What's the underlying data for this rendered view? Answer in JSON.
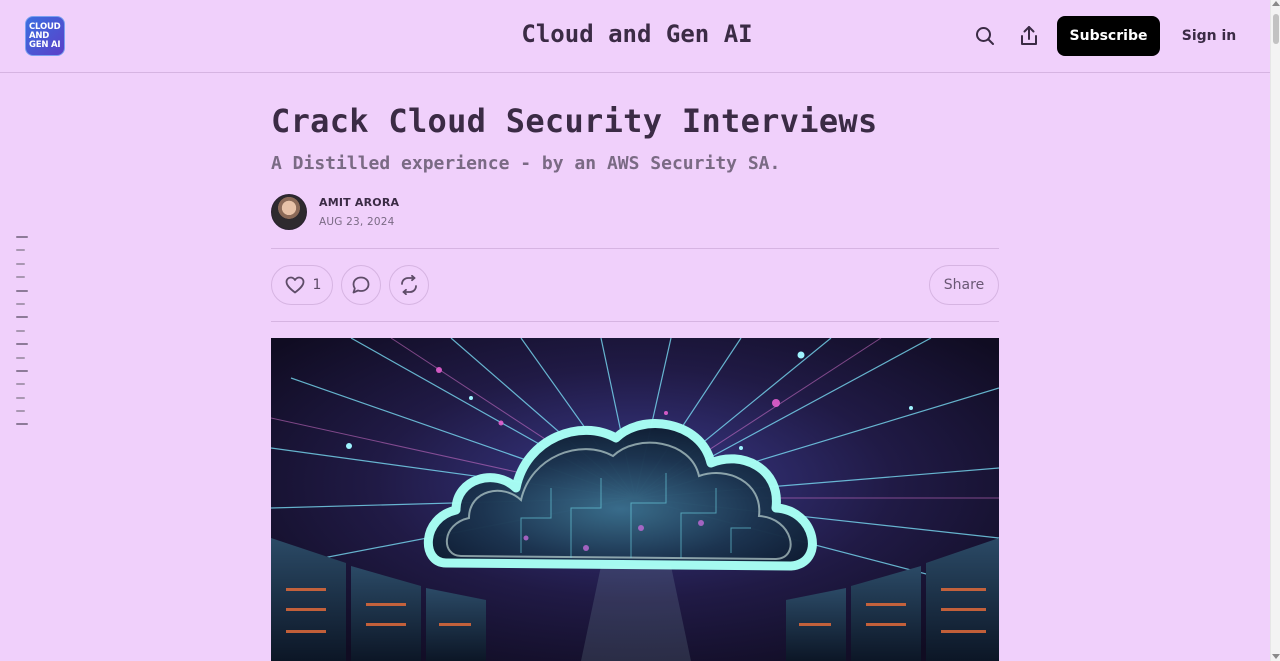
{
  "header": {
    "logo_lines": [
      "CLOUD",
      "AND",
      "GEN AI"
    ],
    "site_title": "Cloud and Gen AI",
    "search_icon": "search-icon",
    "share_icon": "share-icon",
    "subscribe_label": "Subscribe",
    "signin_label": "Sign in"
  },
  "post": {
    "title": "Crack Cloud Security Interviews",
    "subtitle": "A Distilled experience - by an AWS Security SA.",
    "author": "AMIT ARORA",
    "date": "AUG 23, 2024"
  },
  "actions": {
    "like_count": "1",
    "like_icon": "heart-icon",
    "comment_icon": "comment-icon",
    "restack_icon": "restack-icon",
    "share_label": "Share"
  },
  "colors": {
    "background": "#f0d0fb",
    "text": "#3b2b45",
    "button": "#000000",
    "divider": "#d6b4e2"
  }
}
